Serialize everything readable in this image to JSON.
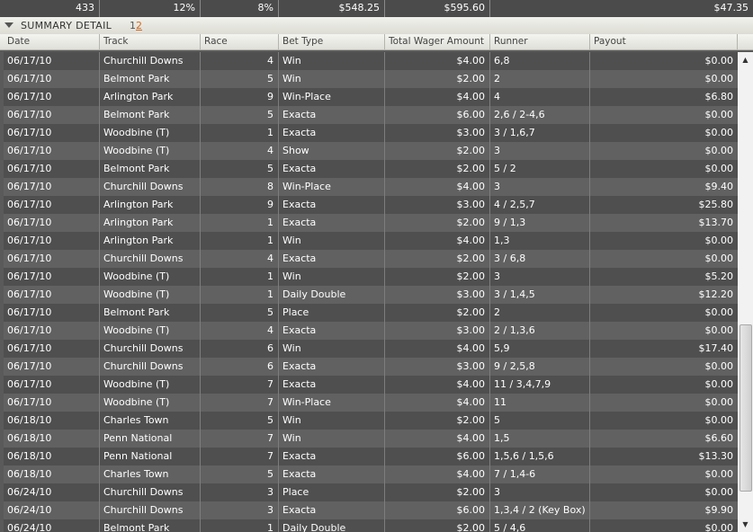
{
  "totals": [
    "433",
    "12%",
    "8%",
    "$548.25",
    "$595.60",
    "$47.35"
  ],
  "summary": {
    "title": "SUMMARY DETAIL",
    "page1": "1",
    "page2": "2"
  },
  "columns": [
    "Date",
    "Track",
    "Race",
    "Bet Type",
    "Total Wager Amount",
    "Runner",
    "Payout"
  ],
  "rows": [
    [
      "06/17/10",
      "Churchill Downs",
      "4",
      "Win",
      "$4.00",
      "6,8",
      "$0.00"
    ],
    [
      "06/17/10",
      "Belmont Park",
      "5",
      "Win",
      "$2.00",
      "2",
      "$0.00"
    ],
    [
      "06/17/10",
      "Arlington Park",
      "9",
      "Win-Place",
      "$4.00",
      "4",
      "$6.80"
    ],
    [
      "06/17/10",
      "Belmont Park",
      "5",
      "Exacta",
      "$6.00",
      "2,6 / 2-4,6",
      "$0.00"
    ],
    [
      "06/17/10",
      "Woodbine (T)",
      "1",
      "Exacta",
      "$3.00",
      "3 / 1,6,7",
      "$0.00"
    ],
    [
      "06/17/10",
      "Woodbine (T)",
      "4",
      "Show",
      "$2.00",
      "3",
      "$0.00"
    ],
    [
      "06/17/10",
      "Belmont Park",
      "5",
      "Exacta",
      "$2.00",
      "5 / 2",
      "$0.00"
    ],
    [
      "06/17/10",
      "Churchill Downs",
      "8",
      "Win-Place",
      "$4.00",
      "3",
      "$9.40"
    ],
    [
      "06/17/10",
      "Arlington Park",
      "9",
      "Exacta",
      "$3.00",
      "4 / 2,5,7",
      "$25.80"
    ],
    [
      "06/17/10",
      "Arlington Park",
      "1",
      "Exacta",
      "$2.00",
      "9 / 1,3",
      "$13.70"
    ],
    [
      "06/17/10",
      "Arlington Park",
      "1",
      "Win",
      "$4.00",
      "1,3",
      "$0.00"
    ],
    [
      "06/17/10",
      "Churchill Downs",
      "4",
      "Exacta",
      "$2.00",
      "3 / 6,8",
      "$0.00"
    ],
    [
      "06/17/10",
      "Woodbine (T)",
      "1",
      "Win",
      "$2.00",
      "3",
      "$5.20"
    ],
    [
      "06/17/10",
      "Woodbine (T)",
      "1",
      "Daily Double",
      "$3.00",
      "3 / 1,4,5",
      "$12.20"
    ],
    [
      "06/17/10",
      "Belmont Park",
      "5",
      "Place",
      "$2.00",
      "2",
      "$0.00"
    ],
    [
      "06/17/10",
      "Woodbine (T)",
      "4",
      "Exacta",
      "$3.00",
      "2 / 1,3,6",
      "$0.00"
    ],
    [
      "06/17/10",
      "Churchill Downs",
      "6",
      "Win",
      "$4.00",
      "5,9",
      "$17.40"
    ],
    [
      "06/17/10",
      "Churchill Downs",
      "6",
      "Exacta",
      "$3.00",
      "9 / 2,5,8",
      "$0.00"
    ],
    [
      "06/17/10",
      "Woodbine (T)",
      "7",
      "Exacta",
      "$4.00",
      "11 / 3,4,7,9",
      "$0.00"
    ],
    [
      "06/17/10",
      "Woodbine (T)",
      "7",
      "Win-Place",
      "$4.00",
      "11",
      "$0.00"
    ],
    [
      "06/18/10",
      "Charles Town",
      "5",
      "Win",
      "$2.00",
      "5",
      "$0.00"
    ],
    [
      "06/18/10",
      "Penn National",
      "7",
      "Win",
      "$4.00",
      "1,5",
      "$6.60"
    ],
    [
      "06/18/10",
      "Penn National",
      "7",
      "Exacta",
      "$6.00",
      "1,5,6 / 1,5,6",
      "$13.30"
    ],
    [
      "06/18/10",
      "Charles Town",
      "5",
      "Exacta",
      "$4.00",
      "7 / 1,4-6",
      "$0.00"
    ],
    [
      "06/24/10",
      "Churchill Downs",
      "3",
      "Place",
      "$2.00",
      "3",
      "$0.00"
    ],
    [
      "06/24/10",
      "Churchill Downs",
      "3",
      "Exacta",
      "$6.00",
      "1,3,4 / 2 (Key Box)",
      "$9.90"
    ],
    [
      "06/24/10",
      "Belmont Park",
      "1",
      "Daily Double",
      "$2.00",
      "5 / 4,6",
      "$0.00"
    ]
  ],
  "icons": {
    "collapse": "collapse-triangle-icon",
    "scroll_up": "scroll-up-icon",
    "scroll_down": "scroll-down-icon"
  }
}
